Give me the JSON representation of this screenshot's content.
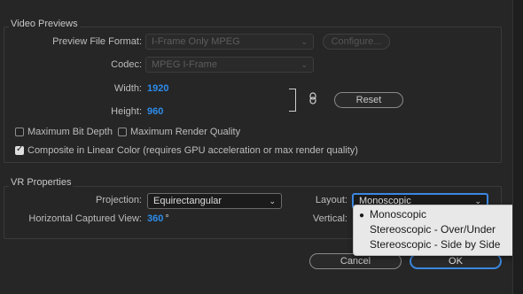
{
  "video_previews": {
    "title": "Video Previews",
    "preview_file_format": {
      "label": "Preview File Format:",
      "value": "I-Frame Only MPEG"
    },
    "configure_button": "Configure...",
    "codec": {
      "label": "Codec:",
      "value": "MPEG I-Frame"
    },
    "width": {
      "label": "Width:",
      "value": "1920"
    },
    "height": {
      "label": "Height:",
      "value": "960"
    },
    "reset_button": "Reset",
    "maximum_bit_depth": {
      "label": "Maximum Bit Depth",
      "checked": false
    },
    "maximum_render_quality": {
      "label": "Maximum Render Quality",
      "checked": false
    },
    "composite_linear": {
      "label": "Composite in Linear Color (requires GPU acceleration or max render quality)",
      "checked": true
    }
  },
  "vr_properties": {
    "title": "VR Properties",
    "projection": {
      "label": "Projection:",
      "value": "Equirectangular"
    },
    "layout": {
      "label": "Layout:",
      "value": "Monoscopic"
    },
    "horizontal_view": {
      "label": "Horizontal Captured View:",
      "value": "360",
      "unit": "°"
    },
    "vertical": {
      "label": "Vertical:"
    }
  },
  "layout_menu": {
    "options": [
      "Monoscopic",
      "Stereoscopic - Over/Under",
      "Stereoscopic - Side by Side"
    ],
    "selected": "Monoscopic"
  },
  "footer": {
    "cancel": "Cancel",
    "ok": "OK"
  },
  "colors": {
    "accent": "#2d8ceb",
    "focus": "#3a87e0"
  }
}
